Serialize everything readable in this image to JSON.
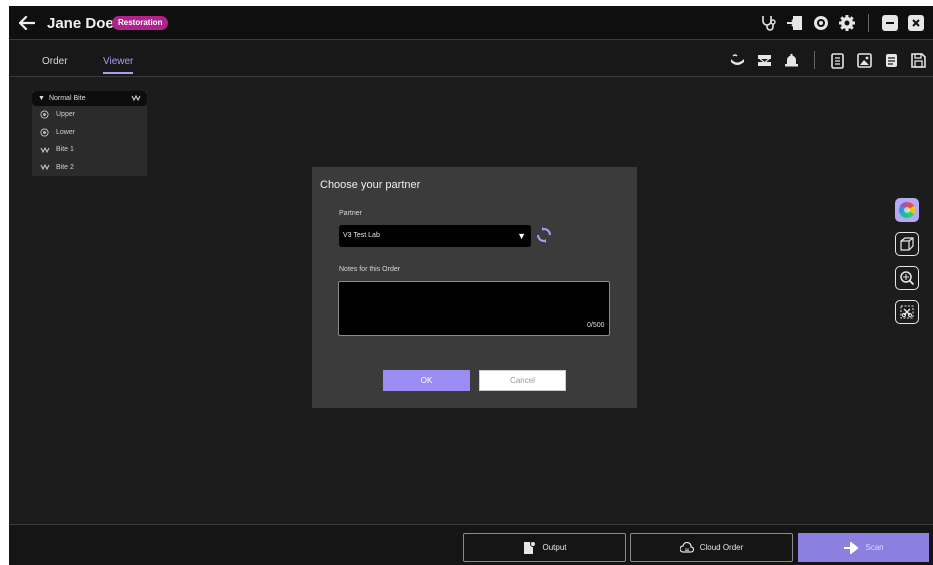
{
  "header": {
    "patient_name": "Jane Doe",
    "badge": "Restoration",
    "badge_color": "#b0238a",
    "tool_icons": [
      "stethoscope-icon",
      "import-icon",
      "target-icon",
      "settings-icon",
      "minimize-icon",
      "close-icon"
    ]
  },
  "tabs": [
    {
      "label": "Order",
      "active": false
    },
    {
      "label": "Viewer",
      "active": true
    }
  ],
  "accent_color": "#a89ef6",
  "view_tools": [
    "jaw-view-icon",
    "occlusion-icon",
    "bell-icon",
    "clipboard-icon",
    "image-icon",
    "notes-icon",
    "save-icon"
  ],
  "layers": {
    "header": "Normal Bite",
    "items": [
      {
        "label": "Upper",
        "icon": "eye-icon"
      },
      {
        "label": "Lower",
        "icon": "eye-icon"
      },
      {
        "label": "Bite 1",
        "icon": "bite-icon"
      },
      {
        "label": "Bite 2",
        "icon": "bite-icon"
      }
    ]
  },
  "side_tools": [
    "color-wheel-icon",
    "cube-icon",
    "zoom-icon",
    "trim-icon"
  ],
  "dialog": {
    "title": "Choose your partner",
    "partner_label": "Partner",
    "partner_value": "V3 Test Lab",
    "notes_label": "Notes for this Order",
    "notes_value": "",
    "counter": "0/500",
    "ok_label": "OK",
    "cancel_label": "Cancel"
  },
  "footer": {
    "output_label": "Output",
    "cloud_order_label": "Cloud Order",
    "scan_label": "Scan"
  }
}
